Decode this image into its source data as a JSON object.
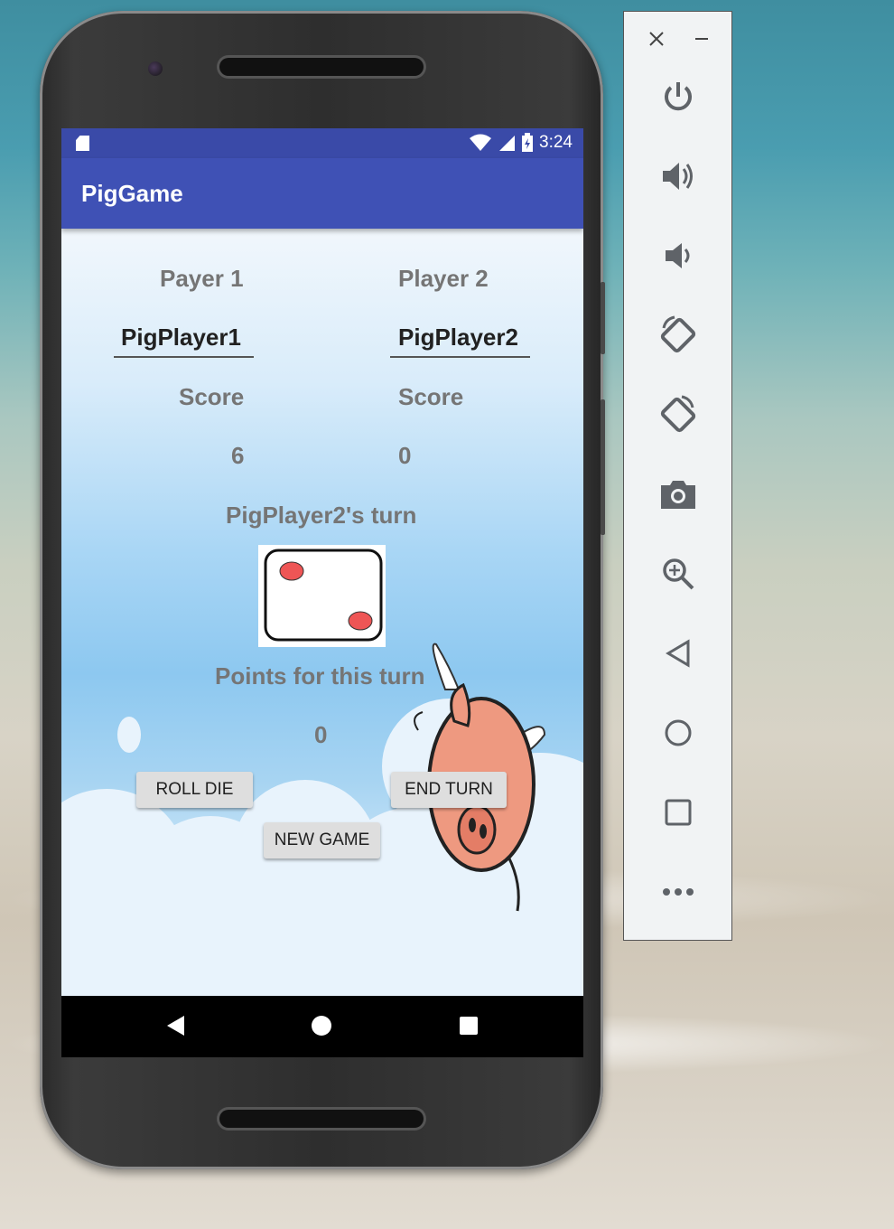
{
  "statusbar": {
    "time": "3:24"
  },
  "app": {
    "title": "PigGame"
  },
  "players": {
    "p1_label": "Payer 1",
    "p2_label": "Player 2",
    "p1_name": "PigPlayer1",
    "p2_name": "PigPlayer2",
    "p1_score_label": "Score",
    "p2_score_label": "Score",
    "p1_score": "6",
    "p2_score": "0"
  },
  "turn": {
    "status": "PigPlayer2's turn",
    "die_value": 2
  },
  "points": {
    "label": "Points for this turn",
    "value": "0"
  },
  "buttons": {
    "roll": "ROLL DIE",
    "end": "END TURN",
    "new_game": "NEW GAME"
  },
  "emulator_panel": {
    "items": [
      "close-icon",
      "minimize-icon",
      "power-icon",
      "volume-up-icon",
      "volume-down-icon",
      "rotate-left-icon",
      "rotate-right-icon",
      "camera-icon",
      "zoom-icon",
      "back-icon",
      "home-icon",
      "overview-icon",
      "more-icon"
    ]
  },
  "colors": {
    "appbar": "#3f51b5",
    "statusbar": "#3a4aa8",
    "die_pip": "#ee5555"
  }
}
